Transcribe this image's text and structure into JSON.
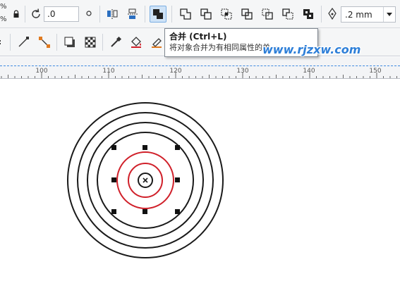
{
  "toolbar": {
    "percent_top": "%",
    "percent_bottom": "%",
    "rotation_value": ".0",
    "outline_width": ".2 mm",
    "icons_row1": [
      "lock-icon",
      "rotate-icon",
      "degree-icon",
      "mirror-horizontal-icon",
      "mirror-vertical-icon",
      "combine-icon",
      "weld-icon",
      "trim-icon",
      "intersect-icon",
      "simplify-icon",
      "front-minus-back-icon",
      "back-minus-front-icon",
      "create-boundary-icon",
      "pen-nib-icon"
    ],
    "icons_row2": [
      "line-tool-icon",
      "connector-icon",
      "drop-shadow-icon",
      "transparency-icon",
      "eyedropper-icon",
      "fill-bucket-icon",
      "smart-fill-icon"
    ]
  },
  "tooltip": {
    "title": "合并 (Ctrl+L)",
    "description": "将对象合并为有相同属性的单一"
  },
  "watermark": "www.rjzxw.com",
  "ruler": {
    "labels": [
      "100",
      "110",
      "120",
      "130",
      "140",
      "150"
    ]
  },
  "colors": {
    "selection_red": "#d0202a",
    "ring_black": "#1a1a1a",
    "accent_blue": "#3f8be0"
  }
}
